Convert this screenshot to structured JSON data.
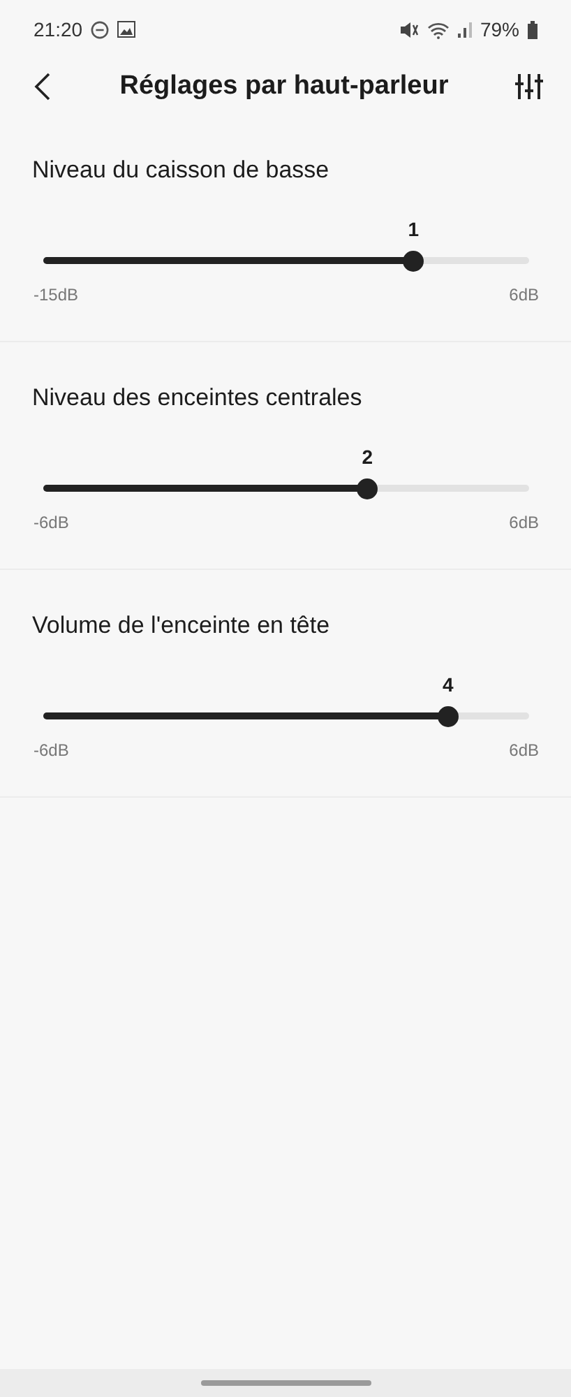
{
  "status_bar": {
    "time": "21:20",
    "battery": "79%"
  },
  "header": {
    "title": "Réglages par haut-parleur"
  },
  "sliders": [
    {
      "label": "Niveau du caisson de basse",
      "value": "1",
      "level": 0.762,
      "min": "-15dB",
      "max": "6dB"
    },
    {
      "label": "Niveau des enceintes centrales",
      "value": "2",
      "level": 0.667,
      "min": "-6dB",
      "max": "6dB"
    },
    {
      "label": "Volume de l'enceinte en tête",
      "value": "4",
      "level": 0.833,
      "min": "-6dB",
      "max": "6dB"
    }
  ]
}
